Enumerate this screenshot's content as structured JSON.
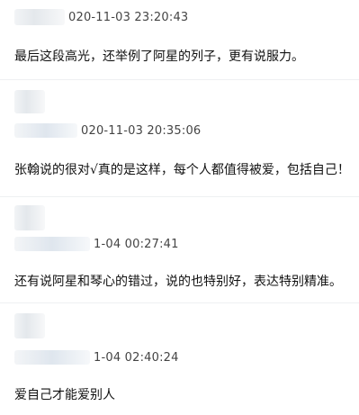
{
  "comments": [
    {
      "timestamp": "020-11-03 23:20:43",
      "text": "最后这段高光，还举例了阿星的列子，更有说服力。"
    },
    {
      "timestamp": "020-11-03 20:35:06",
      "text": "张翰说的很对√真的是这样，每个人都值得被爱，包括自己！"
    },
    {
      "timestamp": "1-04 00:27:41",
      "text": "还有说阿星和琴心的错过，说的也特别好，表达特别精准。"
    },
    {
      "timestamp": "1-04 02:40:24",
      "text": "爱自己才能爱别人"
    }
  ]
}
